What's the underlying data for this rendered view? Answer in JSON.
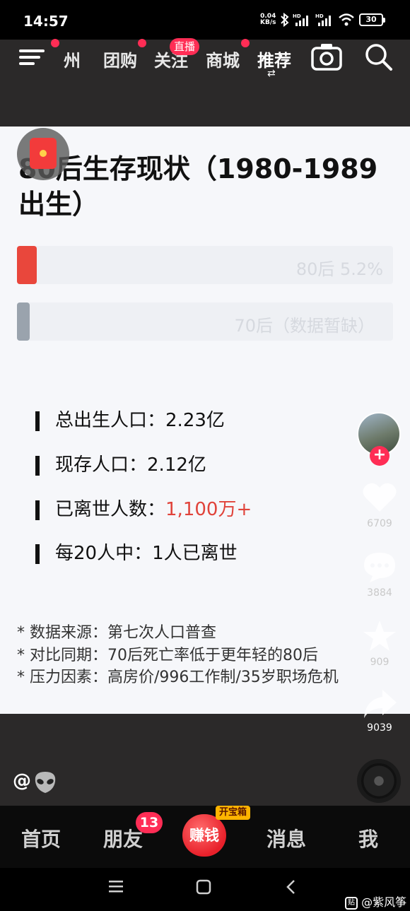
{
  "status_bar": {
    "time": "14:57",
    "net_speed_value": "0.04",
    "net_speed_unit": "KB/s",
    "battery": "30"
  },
  "top_nav": {
    "tabs": [
      "广州",
      "团购",
      "关注",
      "商城",
      "推荐"
    ],
    "tab_first_visible": "州",
    "live_badge": "直播",
    "active_tab": "推荐"
  },
  "post": {
    "title": "80后生存现状（1980-1989出生）",
    "title_line1": "80后生存现状（1980-1989",
    "title_line2": "出生）",
    "bars": [
      {
        "label": "80后 5.2%",
        "value_percent": 5.2,
        "color": "#e9473c"
      },
      {
        "label": "70后（数据暂缺）",
        "value_percent": null,
        "color": "#9aa3ad"
      }
    ],
    "stats": [
      {
        "label": "总出生人口：",
        "value": "2.23亿"
      },
      {
        "label": "现存人口：",
        "value": "2.12亿"
      },
      {
        "label": "已离世人数：",
        "value": "1,100万+"
      },
      {
        "label": "每20人中：",
        "value": "1人已离世"
      }
    ],
    "notes": [
      "* 数据来源：第七次人口普查",
      "* 对比同期：70后死亡率低于更年轻的80后",
      "* 压力因素：高房价/996工作制/35岁职场危机"
    ]
  },
  "rail": {
    "likes": "6709",
    "comments": "3884",
    "favorites": "909",
    "shares": "9039"
  },
  "author": {
    "handle": "@"
  },
  "bottom_nav": {
    "home": "首页",
    "friends": "朋友",
    "friends_badge": "13",
    "earn": "赚钱",
    "treasure": "开宝箱",
    "messages": "消息",
    "me": "我"
  },
  "watermark": {
    "logo": "贴",
    "text": "@紫风筝"
  }
}
